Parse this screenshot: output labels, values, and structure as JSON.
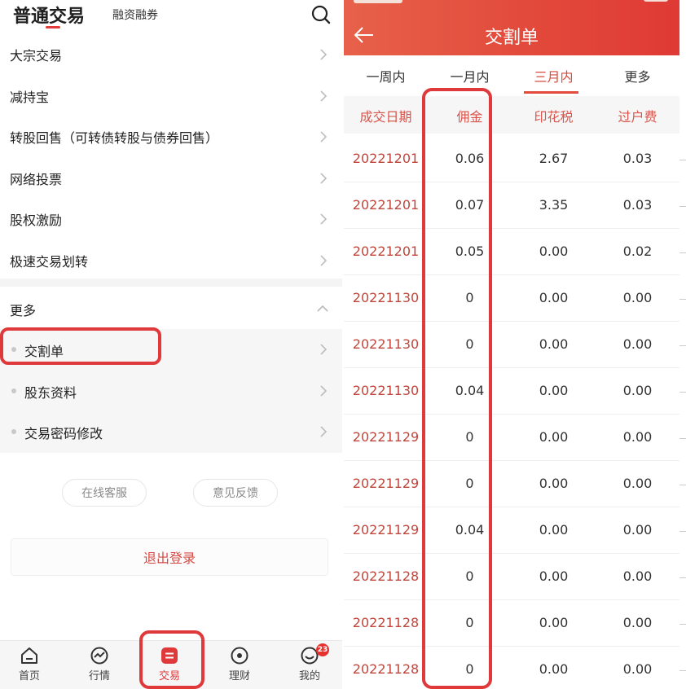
{
  "left": {
    "header": {
      "title": "普通交易",
      "subtitle": "融资融券"
    },
    "menu": [
      {
        "label": "大宗交易"
      },
      {
        "label": "减持宝"
      },
      {
        "label": "转股回售（可转债转股与债券回售）"
      },
      {
        "label": "网络投票"
      },
      {
        "label": "股权激励"
      },
      {
        "label": "极速交易划转"
      }
    ],
    "more": {
      "label": "更多"
    },
    "sub_items": [
      {
        "label": "交割单"
      },
      {
        "label": "股东资料"
      },
      {
        "label": "交易密码修改"
      }
    ],
    "service_buttons": [
      "在线客服",
      "意见反馈"
    ],
    "logout_label": "退出登录",
    "tabbar": {
      "items": [
        {
          "label": "首页",
          "icon": "home-icon"
        },
        {
          "label": "行情",
          "icon": "market-icon"
        },
        {
          "label": "交易",
          "icon": "trade-icon",
          "active": true
        },
        {
          "label": "理财",
          "icon": "wealth-icon"
        },
        {
          "label": "我的",
          "icon": "profile-icon"
        }
      ],
      "badge": "23"
    }
  },
  "right": {
    "title": "交割单",
    "periods": [
      "一周内",
      "一月内",
      "三月内",
      "更多"
    ],
    "active_period": "三月内",
    "columns": [
      "成交日期",
      "佣金",
      "印花税",
      "过户费"
    ],
    "rows": [
      [
        "20221201",
        "0.06",
        "2.67",
        "0.03"
      ],
      [
        "20221201",
        "0.07",
        "3.35",
        "0.03"
      ],
      [
        "20221201",
        "0.05",
        "0.00",
        "0.02"
      ],
      [
        "20221130",
        "0",
        "0.00",
        "0.00"
      ],
      [
        "20221130",
        "0",
        "0.00",
        "0.00"
      ],
      [
        "20221130",
        "0.04",
        "0.00",
        "0.00"
      ],
      [
        "20221129",
        "0",
        "0.00",
        "0.00"
      ],
      [
        "20221129",
        "0",
        "0.00",
        "0.00"
      ],
      [
        "20221129",
        "0.04",
        "0.00",
        "0.00"
      ],
      [
        "20221128",
        "0",
        "0.00",
        "0.00"
      ],
      [
        "20221128",
        "0",
        "0.00",
        "0.00"
      ],
      [
        "20221128",
        "0",
        "0.00",
        "0.00"
      ]
    ]
  },
  "colors": {
    "accent": "#e0393b",
    "header_gradient_start": "#e7614a",
    "header_gradient_end": "#df3a35"
  }
}
